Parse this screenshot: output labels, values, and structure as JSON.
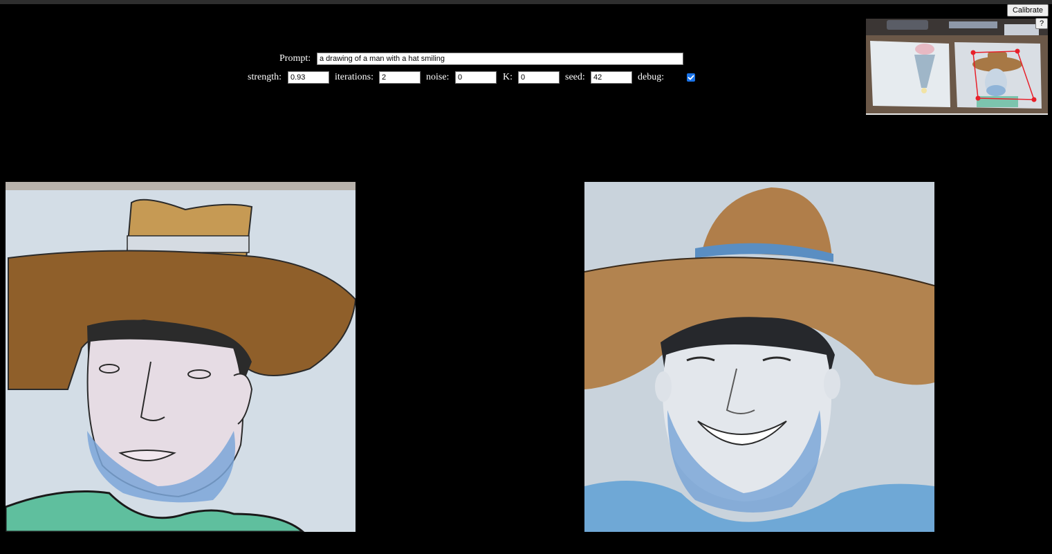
{
  "controls": {
    "prompt_label": "Prompt:",
    "prompt_value": "a drawing of a man with a hat smiling",
    "strength_label": "strength:",
    "strength_value": "0.93",
    "iterations_label": "iterations:",
    "iterations_value": "2",
    "noise_label": "noise:",
    "noise_value": "0",
    "k_label": "K:",
    "k_value": "0",
    "seed_label": "seed:",
    "seed_value": "42",
    "debug_label": "debug:",
    "debug_checked": true
  },
  "buttons": {
    "calibrate_label": "Calibrate",
    "help_label": "?"
  },
  "colors": {
    "background": "#000000",
    "checkbox_accent": "#1a73e8",
    "calibration_marker": "#e8202a"
  },
  "images": {
    "camera_preview": "webcam view of two drawings on a desk with red calibration corner markers",
    "input_drawing": "watercolor drawing of a man in a brown cowboy hat",
    "generated_output": "generated image of a smiling man in a cowboy hat"
  }
}
